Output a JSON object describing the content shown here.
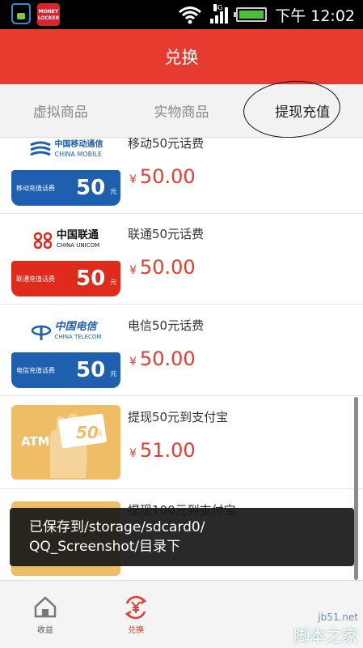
{
  "status_bar": {
    "time": "下午 12:02",
    "network": "3G",
    "app2_label": "MONEY LOCKER"
  },
  "header": {
    "title": "兑换"
  },
  "tabs": [
    {
      "label": "虚拟商品"
    },
    {
      "label": "实物商品"
    },
    {
      "label": "提现充值"
    }
  ],
  "items": [
    {
      "title": "移动50元话费",
      "price_symbol": "¥",
      "price": "50.00",
      "logo_text": "中国移动通信",
      "logo_sub": "CHINA MOBILE",
      "card_label": "移动充值话费",
      "card_value": "50",
      "card_unit": "元",
      "card_color": "#1f5fb0"
    },
    {
      "title": "联通50元话费",
      "price_symbol": "¥",
      "price": "50.00",
      "logo_text": "中国联通",
      "logo_sub": "CHINA UNICOM",
      "card_label": "联通充值话费",
      "card_value": "50",
      "card_unit": "元",
      "card_color": "#e02a1c"
    },
    {
      "title": "电信50元话费",
      "price_symbol": "¥",
      "price": "50.00",
      "logo_text": "中国电信",
      "logo_sub": "CHINA TELECOM",
      "card_label": "电信充值话费",
      "card_value": "50",
      "card_unit": "元",
      "card_color": "#1f5fb0"
    },
    {
      "title": "提现50元到支付宝",
      "price_symbol": "¥",
      "price": "51.00",
      "atm_label": "ATM",
      "atm_value": "50",
      "atm_unit": "元"
    },
    {
      "title": "提现100元到支付宝"
    }
  ],
  "toast": {
    "line1": "已保存到/storage/sdcard0/",
    "line2": "QQ_Screenshot/目录下"
  },
  "bottom_nav": [
    {
      "label": "收益",
      "icon": "house-icon"
    },
    {
      "label": "兑换",
      "icon": "yen-exchange-icon"
    }
  ],
  "watermark": {
    "line1": "jb51.net",
    "line2": "脚本之家"
  },
  "colors": {
    "accent": "#e63b2e",
    "mobile_blue": "#1f5fb0",
    "unicom_red": "#e02a1c",
    "atm_gold": "#efbd66"
  }
}
